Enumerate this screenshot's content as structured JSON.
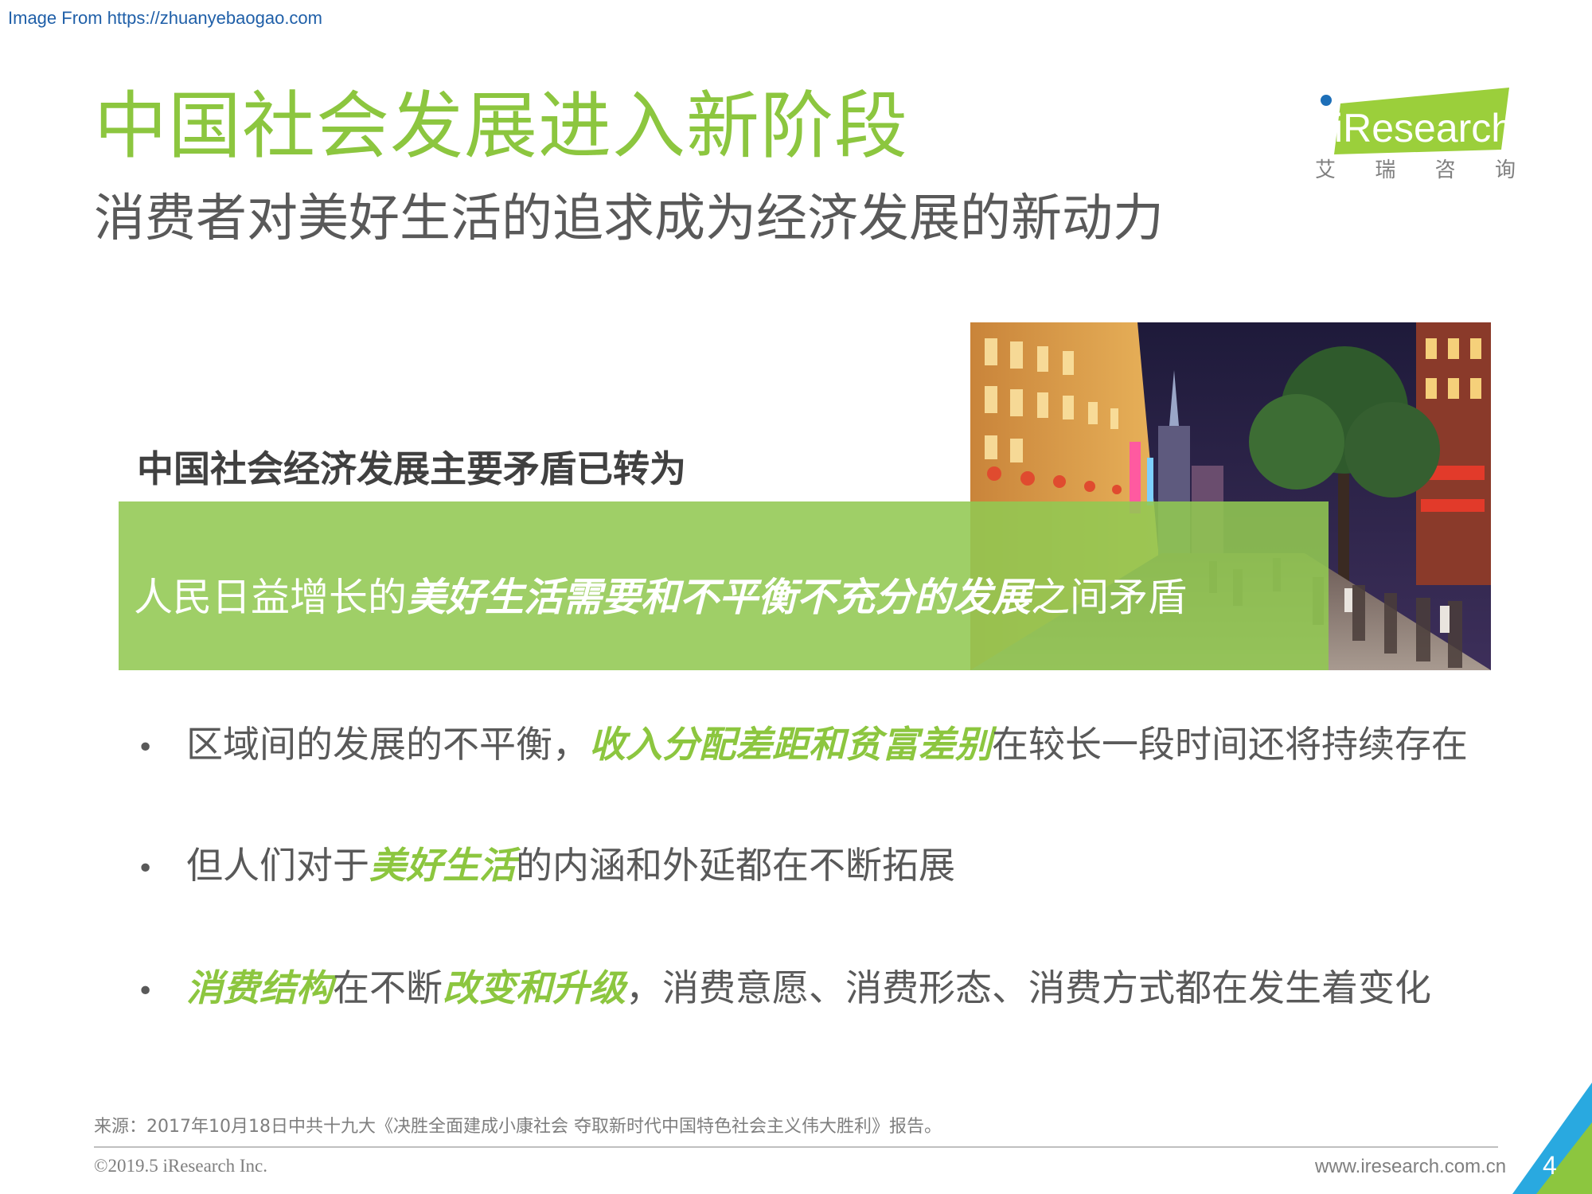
{
  "watermark": "Image From https://zhuanyebaogao.com",
  "title": "中国社会发展进入新阶段",
  "subtitle": "消费者对美好生活的追求成为经济发展的新动力",
  "logo": {
    "wordmark": "iResearch",
    "cn_chars": [
      "艾",
      "瑞",
      "咨",
      "询"
    ],
    "icon": "iresearch-logo"
  },
  "photo": {
    "icon": "city-street-night-photo"
  },
  "box": {
    "heading": "中国社会经济发展主要矛盾已转为",
    "band": {
      "part1": "人民日益增长的",
      "emphasis": "美好生活需要和不平衡不充分的发展",
      "part2": "之间矛盾"
    }
  },
  "bullets": [
    {
      "dot": "•",
      "a": "区域间的发展的不平衡，",
      "b": "收入分配差距和贫富差别",
      "c": "在较长一段时间还将持续存在"
    },
    {
      "dot": "•",
      "a": "但人们对于",
      "b": "美好生活",
      "c": "的内涵和外延都在不断拓展"
    },
    {
      "dot": "•",
      "a": "消费结构",
      "b": "在不断",
      "c": "改变和升级",
      "d": "，消费意愿、消费形态、消费方式都在发生着变化"
    }
  ],
  "footer": {
    "source": "来源：2017年10月18日中共十九大《决胜全面建成小康社会 夺取新时代中国特色社会主义伟大胜利》报告。",
    "copyright": "©2019.5 iResearch Inc.",
    "website": "www.iresearch.com.cn",
    "page_number": "4"
  },
  "colors": {
    "accent_green": "#8cc63f",
    "band_green": "#92c852",
    "text_gray": "#595959",
    "corner_blue": "#29a9e0"
  }
}
